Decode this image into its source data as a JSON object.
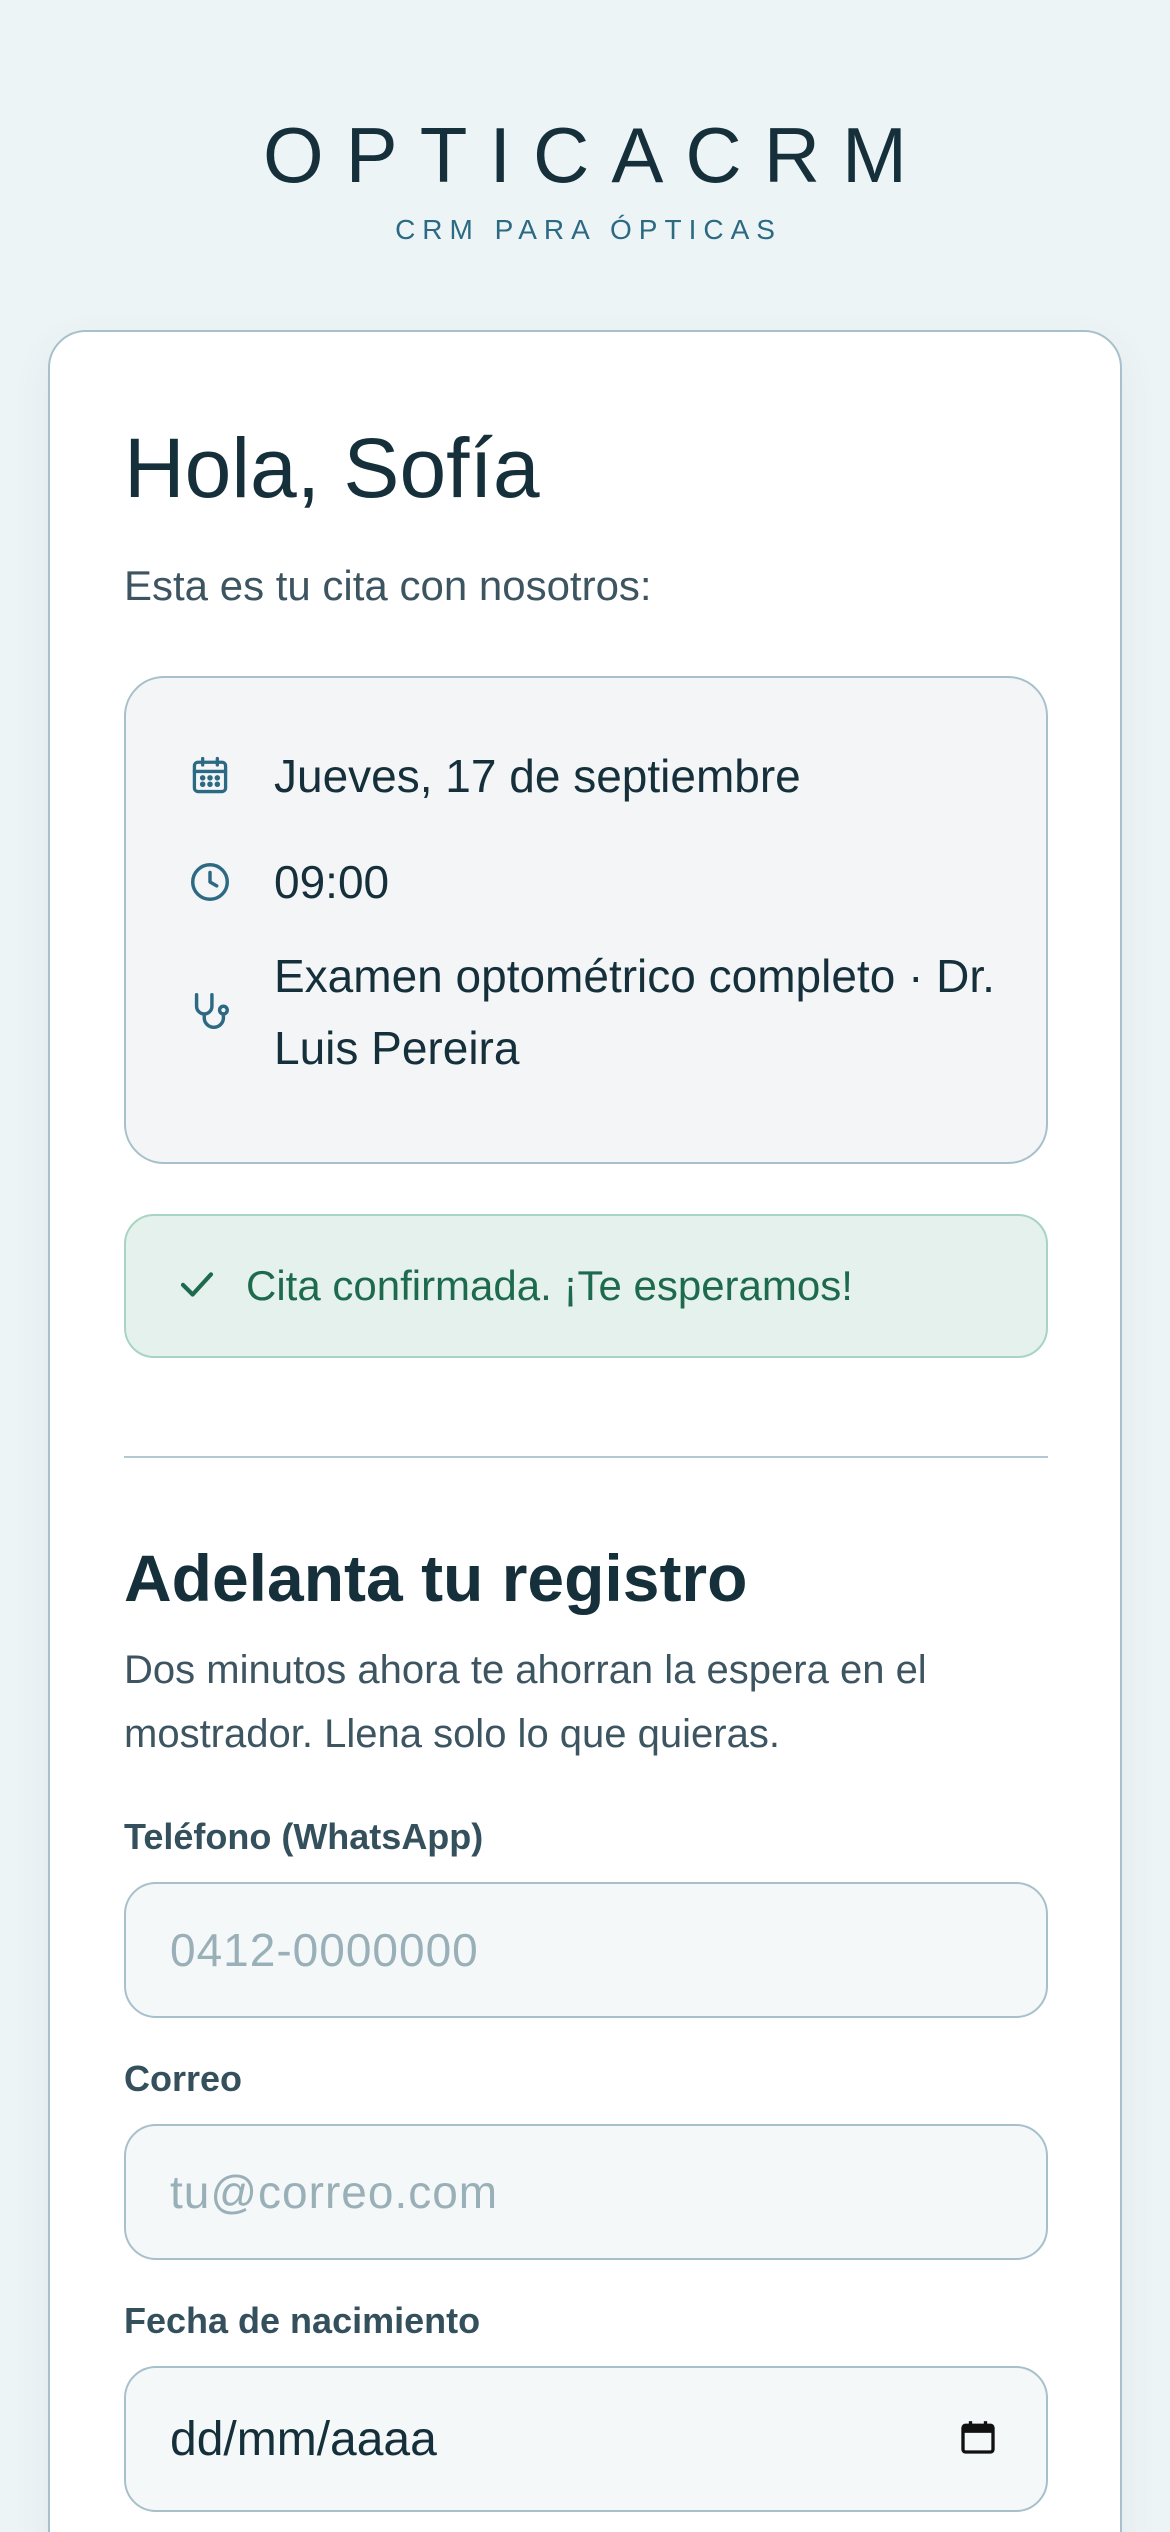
{
  "brand": {
    "name": "OPTICACRM",
    "tagline": "CRM PARA ÓPTICAS"
  },
  "greeting": "Hola, Sofía",
  "intro": "Esta es tu cita con nosotros:",
  "appointment": {
    "date": "Jueves, 17 de septiembre",
    "time": "09:00",
    "service": "Examen optométrico completo · Dr. Luis Pereira",
    "icons": [
      "calendar-icon",
      "clock-icon",
      "stethoscope-icon"
    ]
  },
  "confirmation": {
    "text": "Cita confirmada. ¡Te esperamos!",
    "icon": "check-icon"
  },
  "registration": {
    "title": "Adelanta tu registro",
    "description": "Dos minutos ahora te ahorran la espera en el mostrador. Llena solo lo que quieras.",
    "phone_label": "Teléfono (WhatsApp)",
    "phone_placeholder": "0412-0000000",
    "email_label": "Correo",
    "email_placeholder": "tu@correo.com",
    "birth_label": "Fecha de nacimiento",
    "birth_value": "dd/mm/aaaa"
  },
  "colors": {
    "background": "#edf4f6",
    "accent": "#2c6a84",
    "text": "#15303a",
    "success_bg": "#e4f1ec",
    "success_text": "#1d6a4e"
  }
}
